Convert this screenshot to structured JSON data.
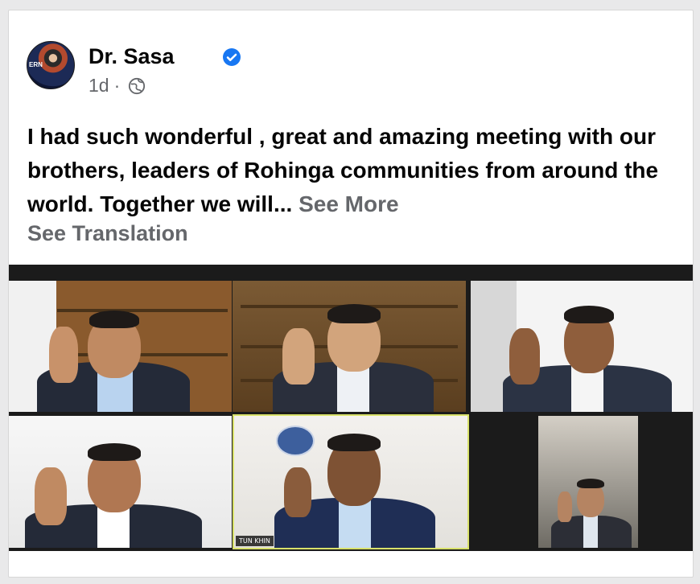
{
  "post": {
    "author": "Dr. Sasa",
    "verified": true,
    "time": "1d",
    "separator": "·",
    "audience_icon": "globe-icon",
    "text": "I had such wonderful , great and amazing meeting with our brothers, leaders of Rohinga communities from around the world. Together we will...",
    "see_more": "See More",
    "see_translation": "See Translation",
    "avatar_text": "ERN"
  },
  "video_call": {
    "participant_label": "TUN KHIN"
  },
  "colors": {
    "text": "#050505",
    "muted": "#65676b",
    "verified_blue": "#1877f2"
  }
}
